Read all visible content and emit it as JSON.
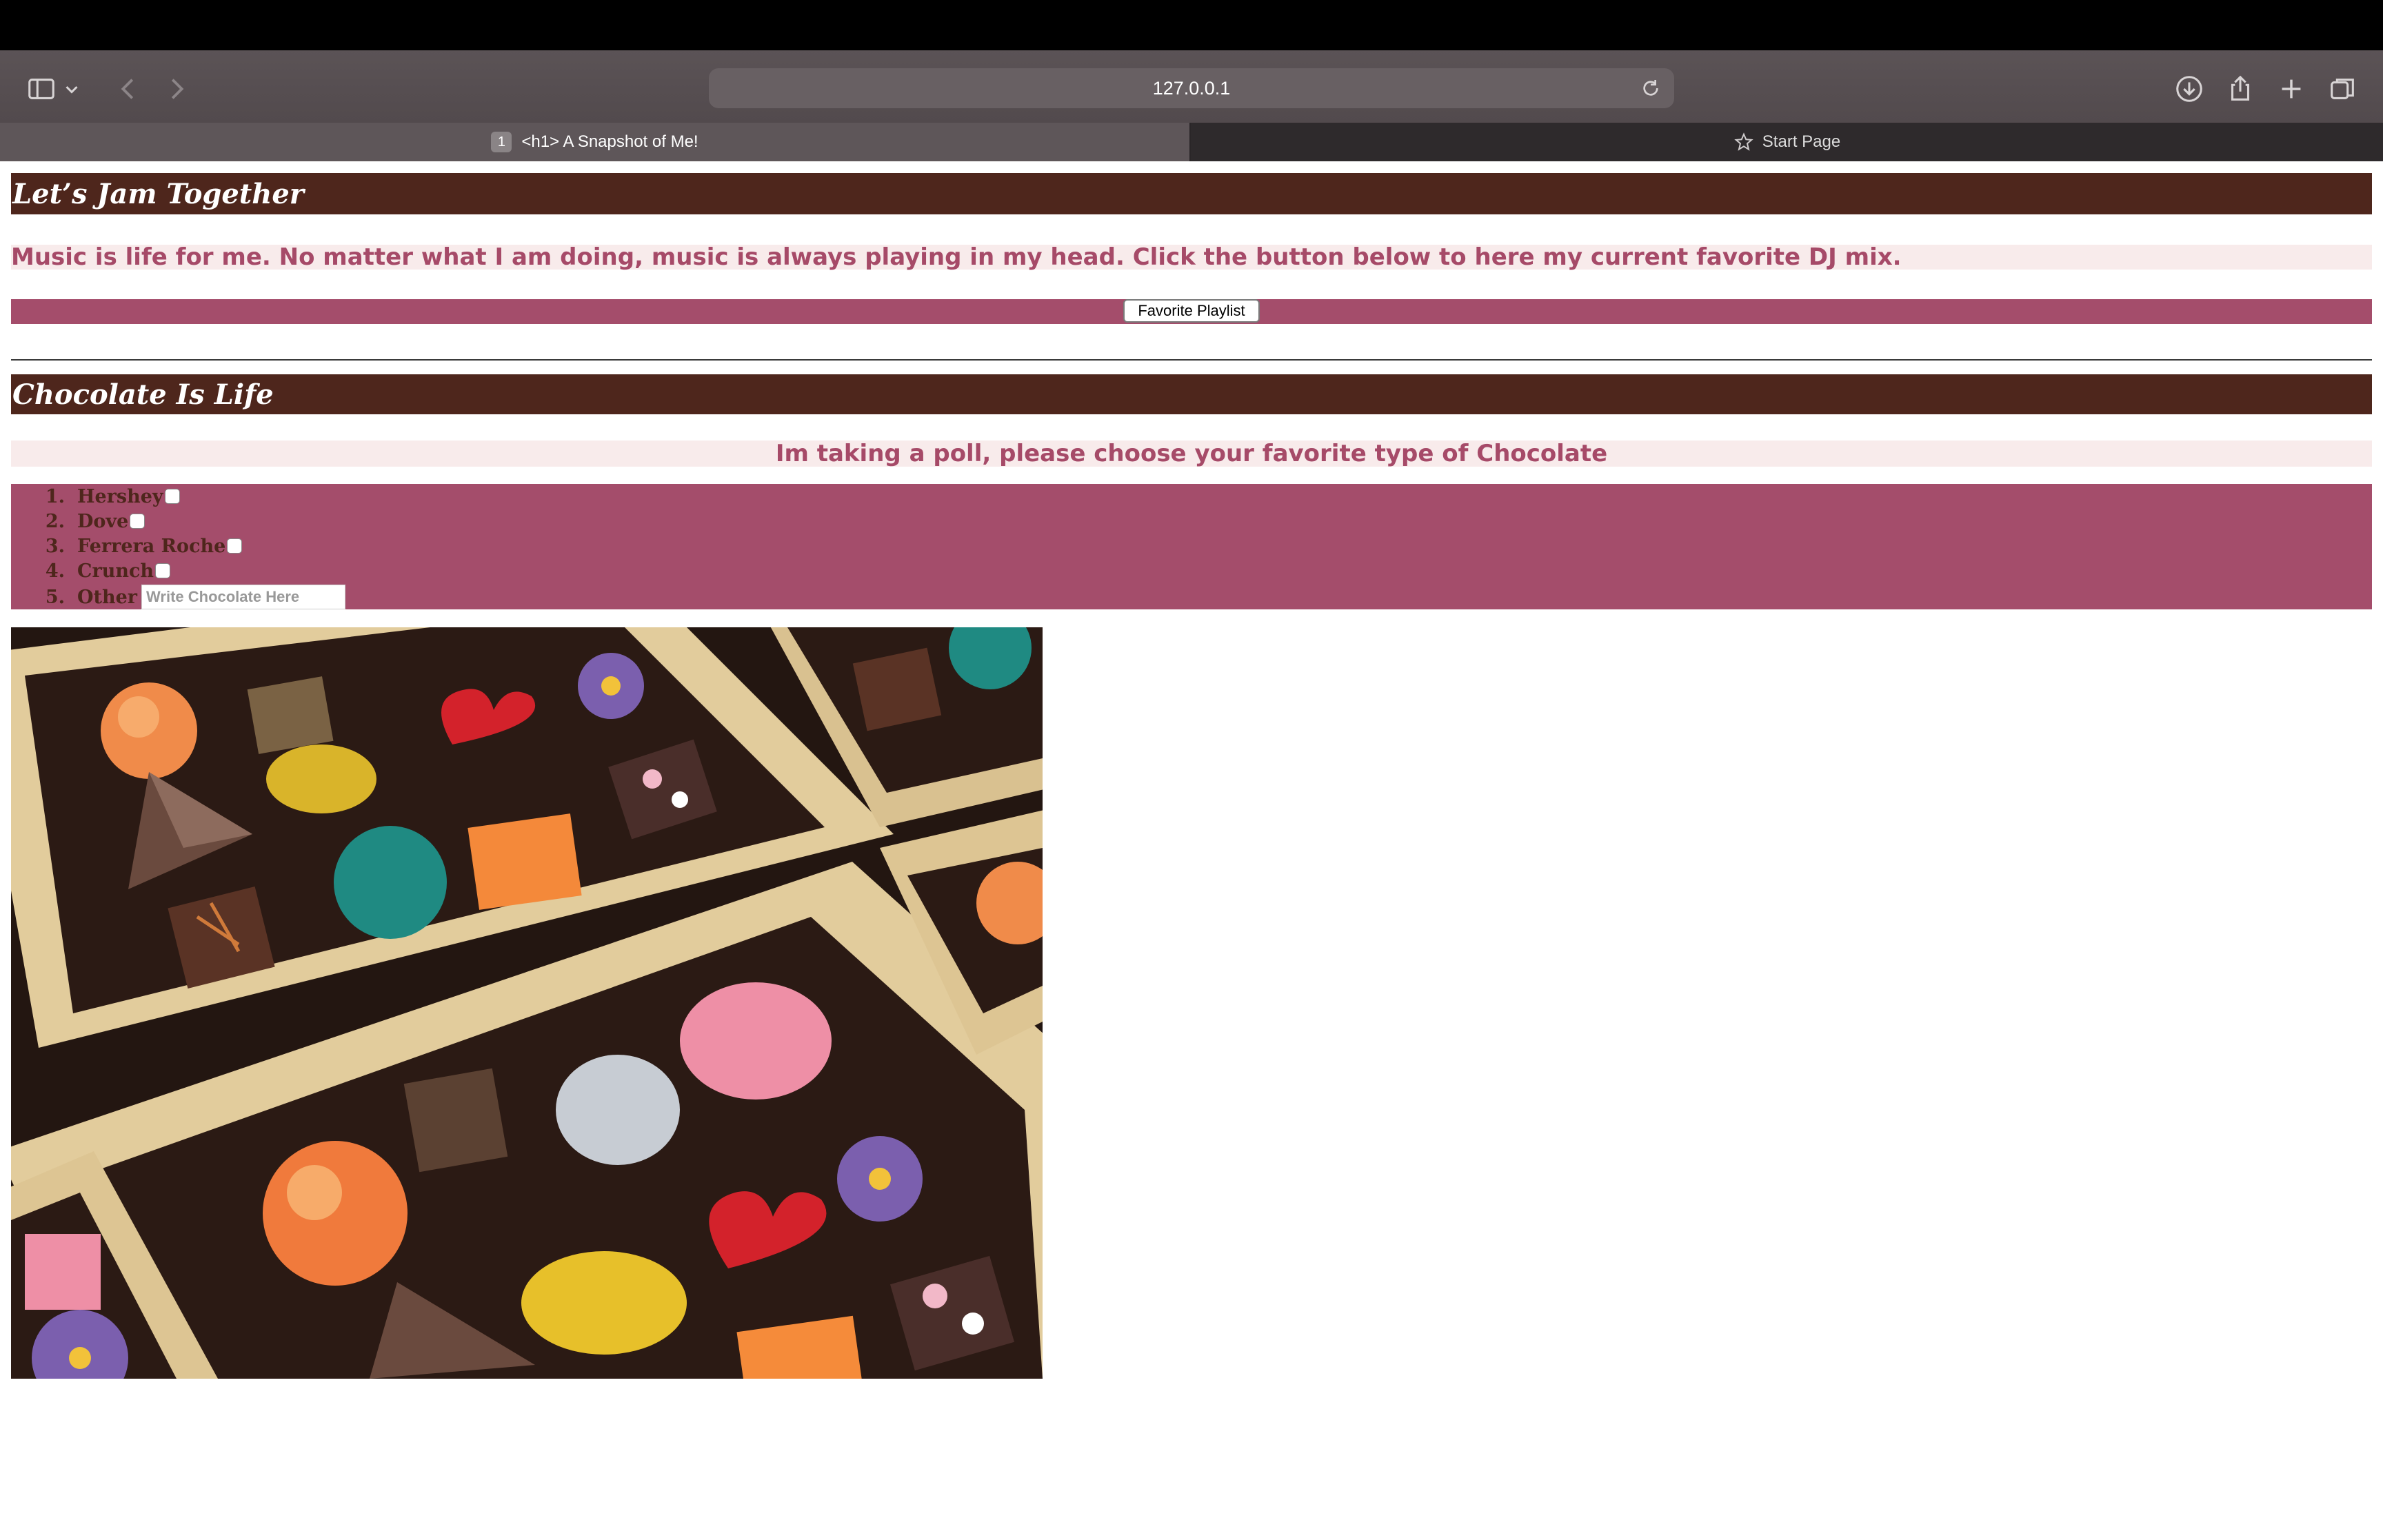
{
  "browser": {
    "url": "127.0.0.1",
    "tabs": [
      {
        "number": "1",
        "label": "<h1> A Snapshot of Me!"
      },
      {
        "label": "Start Page"
      }
    ]
  },
  "jam_section": {
    "heading": "Let’s Jam Together",
    "text": "Music is life for me. No matter what I am doing, music is always playing in my head. Click the button below to here my current favorite DJ mix.",
    "button_label": "Favorite Playlist"
  },
  "chocolate_section": {
    "heading": "Chocolate Is Life",
    "poll_prompt": "Im taking a poll, please choose your favorite type of Chocolate",
    "options": [
      {
        "number": "1.",
        "label": "Hershey"
      },
      {
        "number": "2.",
        "label": "Dove"
      },
      {
        "number": "3.",
        "label": "Ferrera Roche"
      },
      {
        "number": "4.",
        "label": "Crunch"
      },
      {
        "number": "5.",
        "label": "Other"
      }
    ],
    "other_placeholder": "Write Chocolate Here"
  },
  "colors": {
    "heading_bg": "#4e261c",
    "pink_bg": "#f8ebeb",
    "rose_bg": "#a44d6b",
    "pink_text": "#a64a68"
  }
}
